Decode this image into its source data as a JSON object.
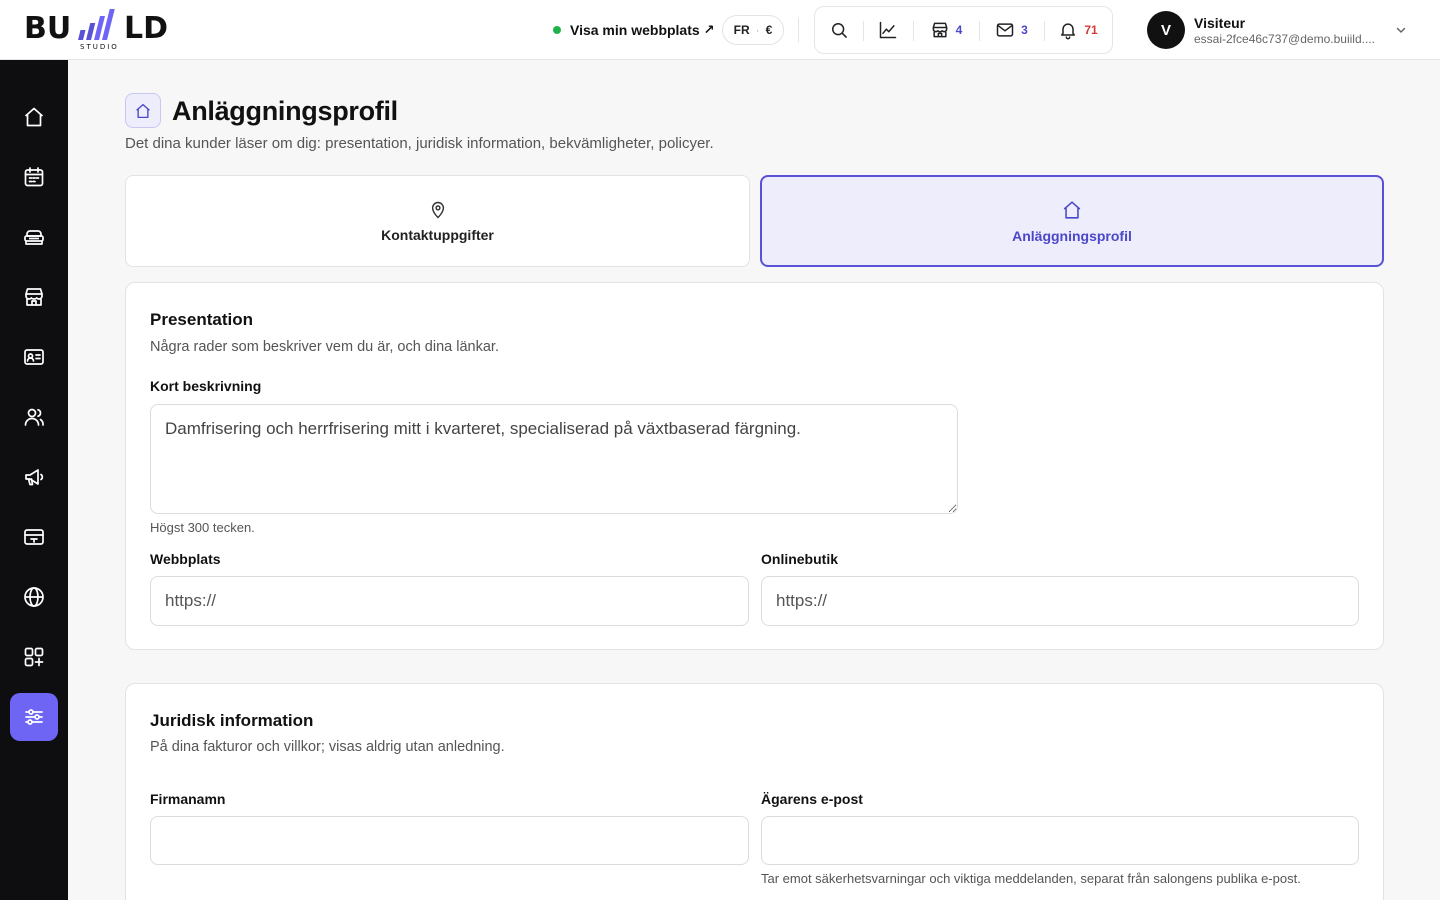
{
  "header": {
    "logo_text": "BUIILD STUDIO",
    "visit_site": "Visa min webbplats",
    "visit_arrow": "↗",
    "lang": "FR",
    "currency": "€",
    "shop_count": "4",
    "mail_count": "3",
    "notif_count": "71",
    "user": {
      "initial": "V",
      "name": "Visiteur",
      "email": "essai-2fce46c737@demo.buiild...."
    }
  },
  "sidebar": {
    "items": [
      {
        "name": "home-icon",
        "active": false
      },
      {
        "name": "calendar-icon",
        "active": false
      },
      {
        "name": "services-icon",
        "active": false
      },
      {
        "name": "store-icon",
        "active": false
      },
      {
        "name": "contact-card-icon",
        "active": false
      },
      {
        "name": "users-icon",
        "active": false
      },
      {
        "name": "megaphone-icon",
        "active": false
      },
      {
        "name": "payment-card-icon",
        "active": false
      },
      {
        "name": "globe-icon",
        "active": false
      },
      {
        "name": "apps-icon",
        "active": false
      },
      {
        "name": "settings-sliders-icon",
        "active": true
      }
    ]
  },
  "page": {
    "title": "Anläggningsprofil",
    "subtitle": "Det dina kunder läser om dig: presentation, juridisk information, bekvämligheter, policyer."
  },
  "tabs": [
    {
      "label": "Kontaktuppgifter",
      "icon": "map-pin-icon",
      "active": false
    },
    {
      "label": "Anläggningsprofil",
      "icon": "home-icon",
      "active": true
    }
  ],
  "presentation": {
    "title": "Presentation",
    "subtitle": "Några rader som beskriver vem du är, och dina länkar.",
    "short_desc_label": "Kort beskrivning",
    "short_desc_value": "Damfrisering och herrfrisering mitt i kvarteret, specialiserad på växtbaserad färgning.",
    "short_desc_hint": "Högst 300 tecken.",
    "website_label": "Webbplats",
    "website_placeholder": "https://",
    "shop_label": "Onlinebutik",
    "shop_placeholder": "https://"
  },
  "legal": {
    "title": "Juridisk information",
    "subtitle": "På dina fakturor och villkor; visas aldrig utan anledning.",
    "company_label": "Firmanamn",
    "company_value": "",
    "owner_email_label": "Ägarens e-post",
    "owner_email_value": "",
    "owner_email_hint": "Tar emot säkerhetsvarningar och viktiga meddelanden, separat från salongens publika e-post."
  },
  "colors": {
    "accent": "#6e65f5",
    "accent_text": "#4b47c9",
    "notif_red": "#d53a3a",
    "online_green": "#22b24c",
    "sidebar_bg": "#0e0e10"
  }
}
